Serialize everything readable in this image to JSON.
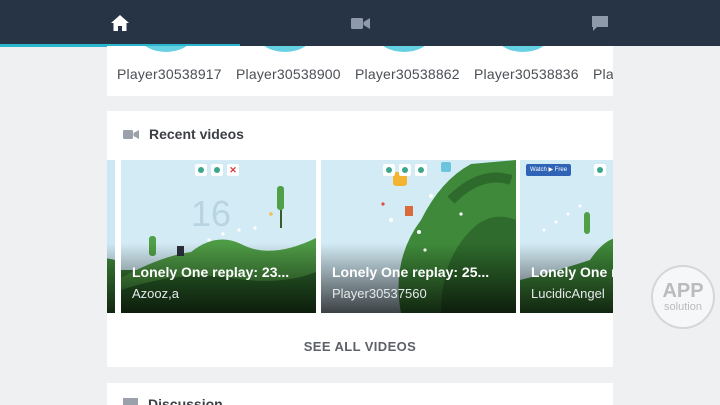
{
  "nav": {
    "tabs": [
      {
        "icon": "home-icon",
        "active": true
      },
      {
        "icon": "video-camera-icon",
        "active": false
      },
      {
        "icon": "chat-icon",
        "active": false
      }
    ],
    "indicator_color": "#2bb6d0",
    "bar_color": "#263445"
  },
  "players": [
    {
      "name": "Player30538917"
    },
    {
      "name": "Player30538900"
    },
    {
      "name": "Player30538862"
    },
    {
      "name": "Player30538836"
    },
    {
      "name": "Pla"
    }
  ],
  "recent_videos": {
    "heading": "Recent videos",
    "icon": "video-camera-icon",
    "items": [
      {
        "title": "Lonely One replay: 23...",
        "author": "Azooz,a",
        "overlay_number": "16"
      },
      {
        "title": "Lonely One replay: 25...",
        "author": "Player30537560"
      },
      {
        "title": "Lonely One r",
        "author": "LucidicAngel",
        "hud_text": "Watch ▶ Free"
      }
    ],
    "see_all_label": "SEE ALL VIDEOS"
  },
  "discussion": {
    "heading": "Discussion",
    "icon": "chat-icon"
  },
  "watermark": {
    "line1": "APP",
    "line2": "solution"
  }
}
